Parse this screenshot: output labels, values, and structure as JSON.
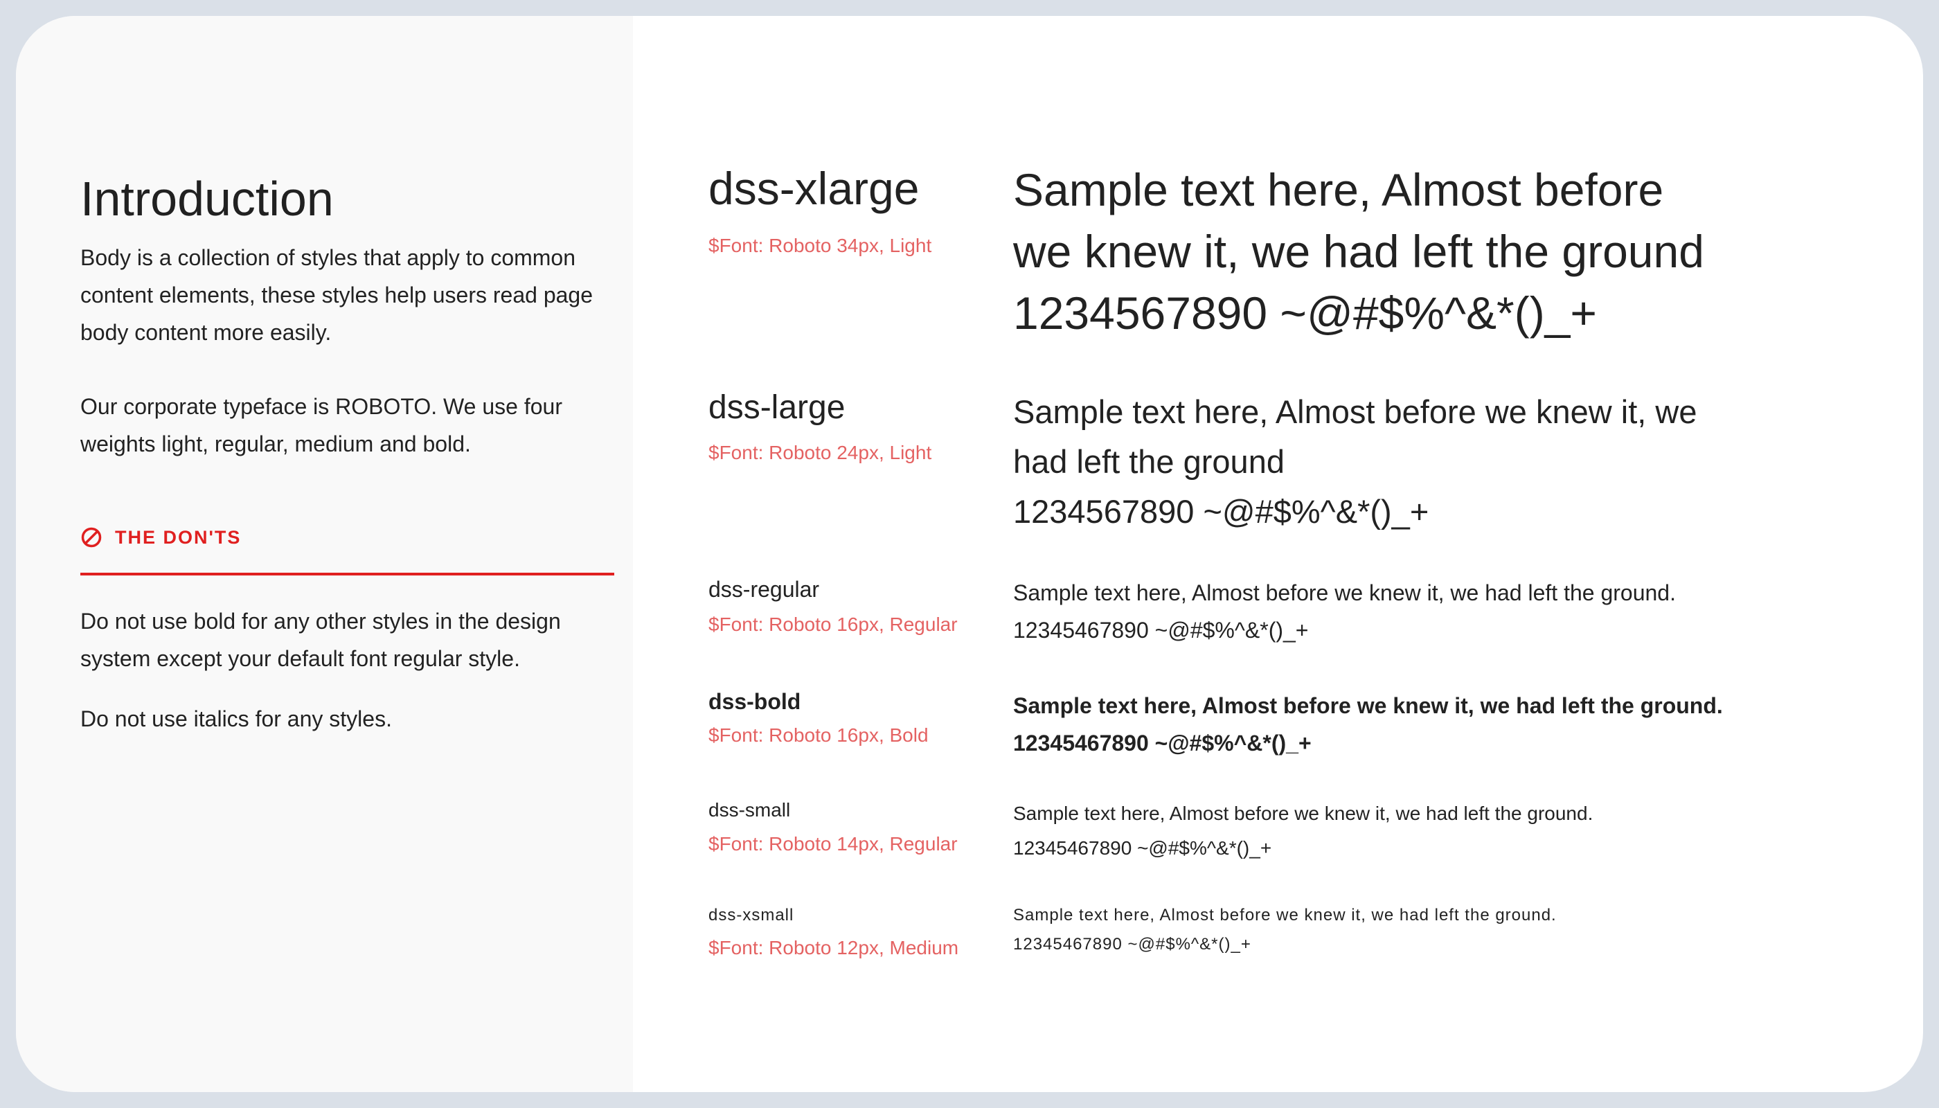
{
  "intro": {
    "title": "Introduction",
    "paragraph1": "Body is a collection of styles that apply to common content elements, these styles help users read page body content more easily.",
    "paragraph2": "Our corporate typeface is ROBOTO. We use four weights light, regular, medium and bold.",
    "donts_icon": "prohibited-icon",
    "donts_heading": "THE DON'TS",
    "dont1": "Do not use bold for any other styles in the design system except your default font regular style.",
    "dont2": "Do not use italics for any styles."
  },
  "colors": {
    "accent_red": "#e02020",
    "meta_red": "#e46262",
    "text": "#222222",
    "left_panel_bg": "#f9f9f9",
    "frame_bg": "#dae0e8"
  },
  "styles": [
    {
      "name": "dss-xlarge",
      "meta": "$Font: Roboto 34px, Light",
      "sample_lines": [
        "Sample text here, Almost before",
        "we knew it, we had left the ground",
        "1234567890 ~@#$%^&*()_+"
      ]
    },
    {
      "name": "dss-large",
      "meta": "$Font: Roboto 24px, Light",
      "sample_lines": [
        "Sample text here, Almost before we knew it, we",
        "had left the ground",
        "1234567890 ~@#$%^&*()_+"
      ]
    },
    {
      "name": "dss-regular",
      "meta": "$Font: Roboto 16px, Regular",
      "sample_lines": [
        "Sample text here, Almost before we knew it, we had left the ground.",
        "12345467890 ~@#$%^&*()_+"
      ]
    },
    {
      "name": "dss-bold",
      "meta": "$Font: Roboto 16px, Bold",
      "sample_lines": [
        "Sample text here, Almost before we knew it, we had left the ground.",
        "12345467890 ~@#$%^&*()_+"
      ]
    },
    {
      "name": "dss-small",
      "meta": "$Font: Roboto 14px, Regular",
      "sample_lines": [
        "Sample text here, Almost before we knew it, we had left the ground.",
        "12345467890 ~@#$%^&*()_+"
      ]
    },
    {
      "name": "dss-xsmall",
      "meta": "$Font: Roboto 12px, Medium",
      "sample_lines": [
        "Sample text here, Almost before we knew it, we had left the ground.",
        "12345467890 ~@#$%^&*()_+"
      ]
    }
  ]
}
